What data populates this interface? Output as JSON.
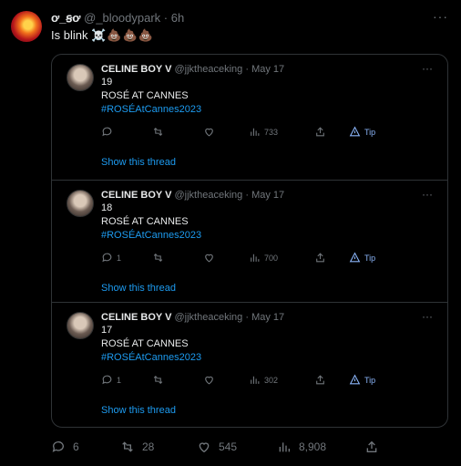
{
  "outer": {
    "display_name": "ơ_ꞩơ",
    "handle": "@_bloodypark",
    "dot": "·",
    "time": "6h",
    "more": "···",
    "text": "Is blink",
    "emojis": "☠️💩💩💩"
  },
  "quoted": [
    {
      "name": "CELINE BOY V",
      "handle": "@jjktheaceking",
      "dot": "·",
      "time": "May 17",
      "line1": "19",
      "line2": "ROSÉ AT CANNES",
      "hashtag": "#ROSÉAtCannes2023",
      "reply_count": "",
      "views": "733",
      "tip": "Tip",
      "show_thread": "Show this thread"
    },
    {
      "name": "CELINE BOY V",
      "handle": "@jjktheaceking",
      "dot": "·",
      "time": "May 17",
      "line1": "18",
      "line2": "ROSÉ AT CANNES",
      "hashtag": "#ROSÉAtCannes2023",
      "reply_count": "1",
      "views": "700",
      "tip": "Tip",
      "show_thread": "Show this thread"
    },
    {
      "name": "CELINE BOY V",
      "handle": "@jjktheaceking",
      "dot": "·",
      "time": "May 17",
      "line1": "17",
      "line2": "ROSÉ AT CANNES",
      "hashtag": "#ROSÉAtCannes2023",
      "reply_count": "1",
      "views": "302",
      "tip": "Tip",
      "show_thread": "Show this thread"
    }
  ],
  "actions": {
    "replies": "6",
    "retweets": "28",
    "likes": "545",
    "views": "8,908"
  },
  "icons": [
    "avatar",
    "more-icon",
    "reply-icon",
    "retweet-icon",
    "like-icon",
    "views-icon",
    "share-icon",
    "tip-icon"
  ],
  "colors": {
    "background": "#000000",
    "text": "#e7e9ea",
    "muted": "#71767b",
    "link": "#1d9bf0",
    "border": "#2f3336"
  }
}
